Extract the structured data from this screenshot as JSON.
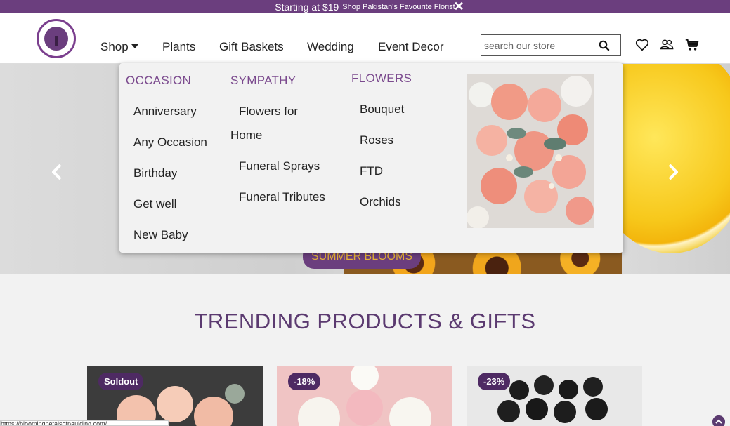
{
  "promo": {
    "lead": "Starting at $19",
    "sub": "Shop Pakistan's Favourite Florist"
  },
  "nav": {
    "shop": "Shop",
    "plants": "Plants",
    "gift_baskets": "Gift Baskets",
    "wedding": "Wedding",
    "event_decor": "Event Decor"
  },
  "search": {
    "placeholder": "search our store",
    "value": ""
  },
  "icons": [
    "close-icon",
    "search-icon",
    "heart-icon",
    "account-icon",
    "cart-icon",
    "chevron-left-icon",
    "chevron-right-icon",
    "arrow-up-icon"
  ],
  "hero": {
    "button": "SUMMER BLOOMS"
  },
  "mega_menu": {
    "occasion": {
      "heading": "OCCASION",
      "items": [
        "Anniversary",
        "Any Occasion",
        "Birthday",
        "Get well",
        "New Baby"
      ]
    },
    "sympathy": {
      "heading": "SYMPATHY",
      "item1_line1": "Flowers for",
      "item1_line2": "Home",
      "item2": "Funeral Sprays",
      "item3": "Funeral Tributes"
    },
    "flowers": {
      "heading": "FLOWERS",
      "items": [
        "Bouquet",
        "Roses",
        "FTD",
        "Orchids"
      ]
    }
  },
  "trending": {
    "title": "TRENDING PRODUCTS & GIFTS",
    "badges": [
      "Soldout",
      "-18%",
      "-23%"
    ]
  },
  "status": {
    "url": "https://bloomingpetalsofpaulding.com/..."
  },
  "colors": {
    "brand": "#6b3e7e",
    "accent": "#7b4a8e",
    "hero_button_text": "#e7b33a"
  }
}
